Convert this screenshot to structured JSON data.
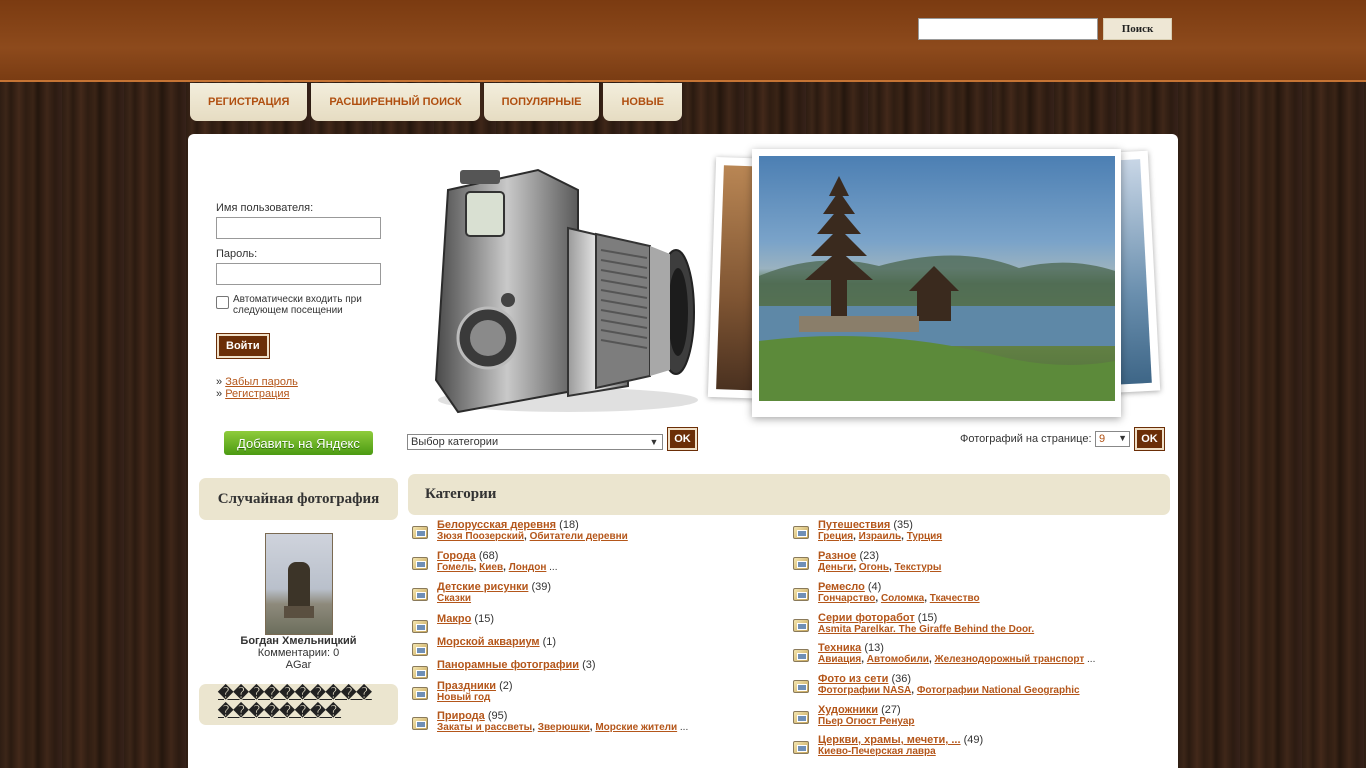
{
  "header": {
    "search_placeholder": "",
    "search_button": "Поиск"
  },
  "nav": [
    {
      "label": "РЕГИСТРАЦИЯ"
    },
    {
      "label": "РАСШИРЕННЫЙ ПОИСК"
    },
    {
      "label": "ПОПУЛЯРНЫЕ"
    },
    {
      "label": "НОВЫЕ"
    }
  ],
  "login": {
    "username_label": "Имя пользователя:",
    "username_value": "",
    "password_label": "Пароль:",
    "password_value": "",
    "remember_label": "Автоматически входить при следующем посещении",
    "remember_checked": false,
    "submit_label": "Войти",
    "forgot_link": "Забыл пароль",
    "register_link": "Регистрация",
    "bullet": "»"
  },
  "yandex_button": "Добавить на Яндекс",
  "random_photo": {
    "heading": "Случайная фотография",
    "title": "Богдан Хмельницкий",
    "comments": "Комментарии: 0",
    "author": "AGar"
  },
  "broken_box_text": "���������� ��������",
  "toolbar": {
    "category_select_value": "Выбор категории",
    "ok_label": "OK",
    "per_page_label": "Фотографий на странице:",
    "per_page_value": "9"
  },
  "categories": {
    "heading": "Категории",
    "left": [
      {
        "name": "Белорусская деревня",
        "count": "(18)",
        "subs": [
          "Зюзя Поозерский",
          "Обитатели деревни"
        ],
        "more": ""
      },
      {
        "name": "Города",
        "count": "(68)",
        "subs": [
          "Гомель",
          "Киев",
          "Лондон"
        ],
        "more": "..."
      },
      {
        "name": "Детские рисунки",
        "count": "(39)",
        "subs": [
          "Сказки"
        ],
        "more": ""
      },
      {
        "name": "Макро",
        "count": "(15)",
        "subs": [],
        "more": ""
      },
      {
        "name": "Морской аквариум",
        "count": "(1)",
        "subs": [],
        "more": ""
      },
      {
        "name": "Панорамные фотографии",
        "count": "(3)",
        "subs": [],
        "more": ""
      },
      {
        "name": "Праздники",
        "count": "(2)",
        "subs": [
          "Новый год"
        ],
        "more": ""
      },
      {
        "name": "Природа",
        "count": "(95)",
        "subs": [
          "Закаты и рассветы",
          "Зверюшки",
          "Морские жители"
        ],
        "more": "..."
      }
    ],
    "right": [
      {
        "name": "Путешествия",
        "count": "(35)",
        "subs": [
          "Греция",
          "Израиль",
          "Турция"
        ],
        "more": ""
      },
      {
        "name": "Разное",
        "count": "(23)",
        "subs": [
          "Деньги",
          "Огонь",
          "Текстуры"
        ],
        "more": ""
      },
      {
        "name": "Ремесло",
        "count": "(4)",
        "subs": [
          "Гончарство",
          "Соломка",
          "Ткачество"
        ],
        "more": ""
      },
      {
        "name": "Серии фоторабот",
        "count": "(15)",
        "subs": [
          "Asmita Parelkar. The Giraffe Behind the Door."
        ],
        "more": ""
      },
      {
        "name": "Техника",
        "count": "(13)",
        "subs": [
          "Авиация",
          "Автомобили",
          "Железнодорожный транспорт"
        ],
        "more": "..."
      },
      {
        "name": "Фото из сети",
        "count": "(36)",
        "subs": [
          "Фотографии NASA",
          "Фотографии National Geographic"
        ],
        "more": ""
      },
      {
        "name": "Художники",
        "count": "(27)",
        "subs": [
          "Пьер Огюст Ренуар"
        ],
        "more": ""
      },
      {
        "name": "Церкви, храмы, мечети, ...",
        "count": "(49)",
        "subs": [
          "Киево-Печерская лавра"
        ],
        "more": ""
      }
    ]
  }
}
